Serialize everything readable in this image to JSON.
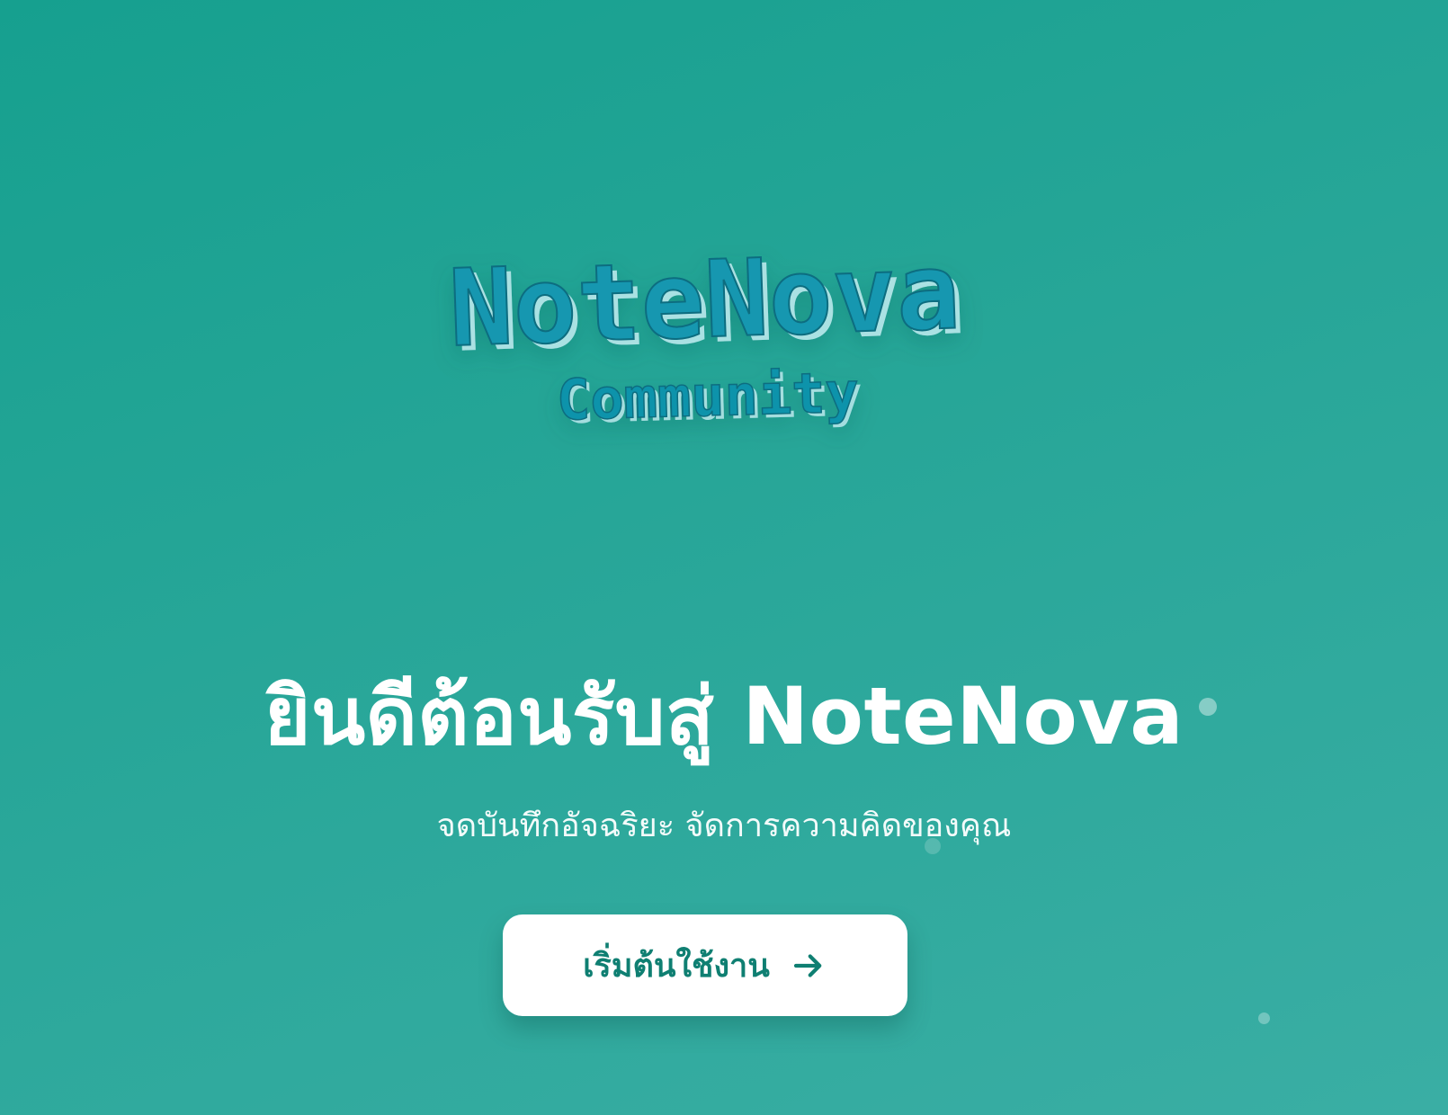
{
  "logo": {
    "title": "NoteNova",
    "subtitle": "Community"
  },
  "hero": {
    "title": "ยินดีต้อนรับสู่ NoteNova",
    "subtitle": "จดบันทึกอัจฉริยะ จัดการความคิดของคุณ"
  },
  "cta": {
    "label": "เริ่มต้นใช้งาน",
    "icon": "arrow-right-icon"
  },
  "colors": {
    "background_start": "#16a08f",
    "background_end": "#3aaea4",
    "logo_fill": "#1397b0",
    "button_background": "#ffffff",
    "button_text": "#0f7f72"
  }
}
